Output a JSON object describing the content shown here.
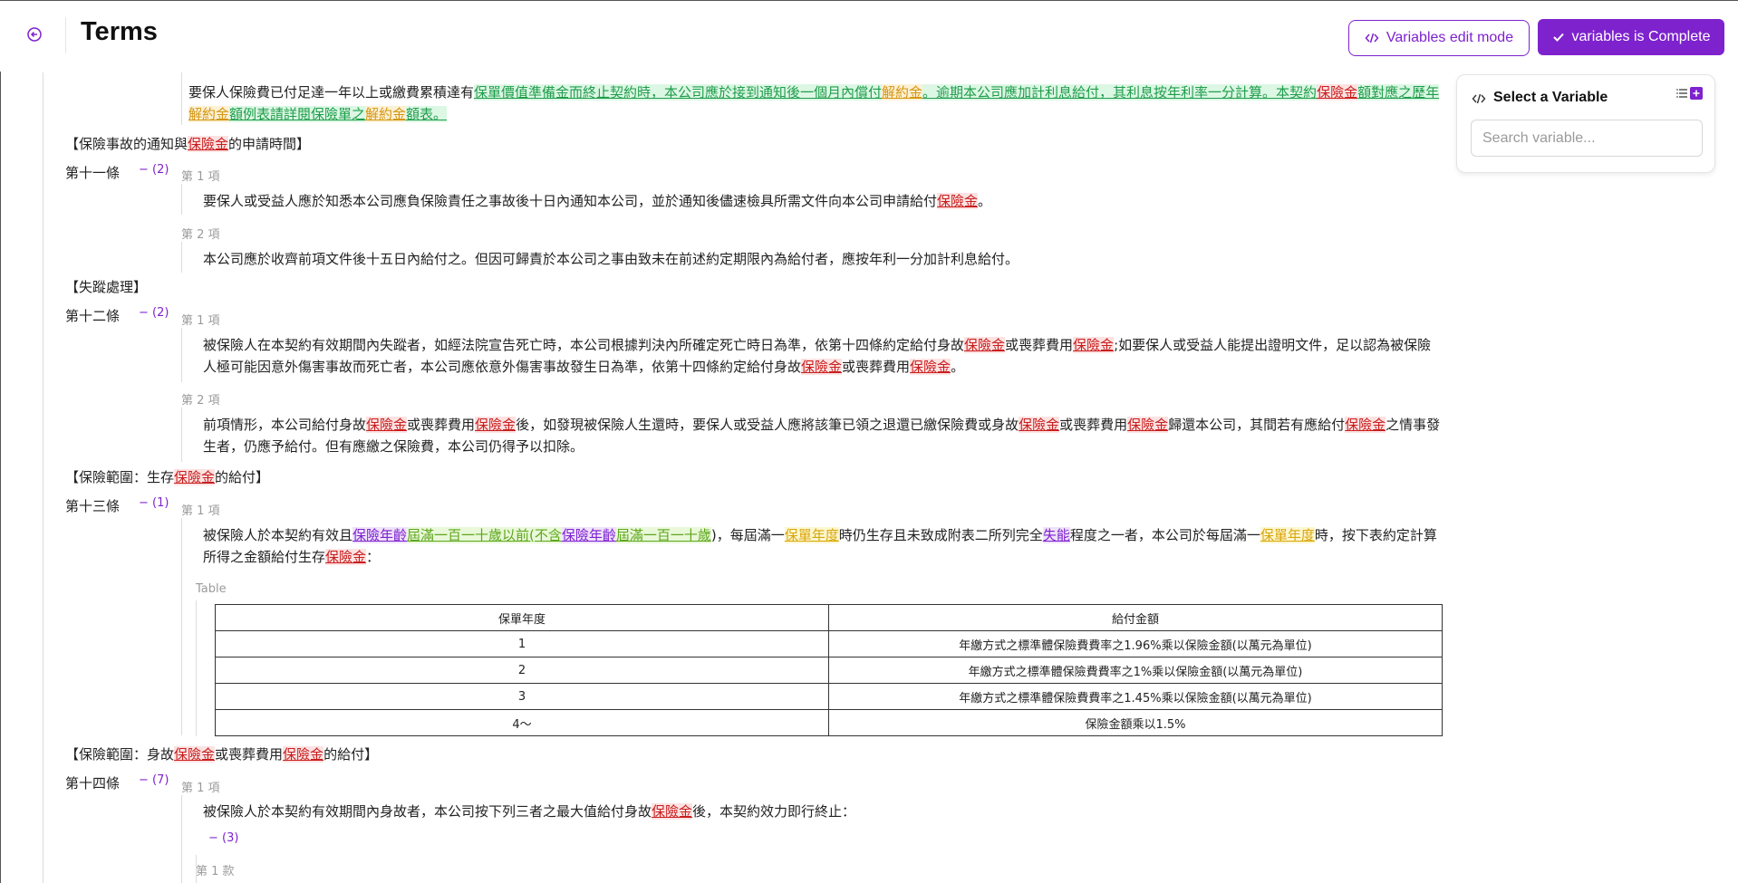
{
  "header": {
    "title": "Terms",
    "edit_mode_label": "Variables edit mode",
    "complete_label": "variables is Complete"
  },
  "variable_panel": {
    "title": "Select a Variable",
    "search_placeholder": "Search variable..."
  },
  "colors": {
    "accent": "#7e22ce",
    "red_var": "#c81e1e",
    "green_var": "#1f9d4b",
    "orange_var": "#d39612"
  },
  "content": {
    "top_para": {
      "a": "要保人保險費已付足達一年以上或繳費累積達有",
      "b": "保單價值準備金而終止契約時，本公司應於接到通知後一個月內償付",
      "c": "解約金",
      "d": "。逾期本公司應加計利息給付，其利息按年利率一分計算。本契約",
      "e": "保險金",
      "f": "額對應之歷年",
      "g": "解約金",
      "h": "額例表請詳閱保險單之",
      "i": "解約金",
      "j": "額表。"
    },
    "sec1": {
      "a": "【保險事故的通知與",
      "b": "保險金",
      "c": "的申請時間】"
    },
    "art11": {
      "label": "第十一條",
      "count": "− (2)",
      "item1": "第 1 項",
      "item2": "第 2 項",
      "p1a": "要保人或受益人應於知悉本公司應負保險責任之事故後十日內通知本公司，並於通知後儘速檢具所需文件向本公司申請給付",
      "p1b": "保險金",
      "p1c": "。",
      "p2": "本公司應於收齊前項文件後十五日內給付之。但因可歸責於本公司之事由致未在前述約定期限內為給付者，應按年利一分加計利息給付。"
    },
    "sec2": "【失蹤處理】",
    "art12": {
      "label": "第十二條",
      "count": "− (2)",
      "item1": "第 1 項",
      "item2": "第 2 項",
      "p1a": "被保險人在本契約有效期間內失蹤者，如經法院宣告死亡時，本公司根據判決內所確定死亡時日為準，依第十四條約定給付身故",
      "p1b": "保險金",
      "p1c": "或喪葬費用",
      "p1d": "保險金",
      "p1e": ";如要保人或受益人能提出證明文件，足以認為被保險人極可能因意外傷害事故而死亡者，本公司應依意外傷害事故發生日為準，依第十四條約定給付身故",
      "p1f": "保險金",
      "p1g": "或喪葬費用",
      "p1h": "保險金",
      "p1i": "。",
      "p2a": "前項情形，本公司給付身故",
      "p2b": "保險金",
      "p2c": "或喪葬費用",
      "p2d": "保險金",
      "p2e": "後，如發現被保險人生還時，要保人或受益人應將該筆已領之退還已繳保險費或身故",
      "p2f": "保險金",
      "p2g": "或喪葬費用",
      "p2h": "保險金",
      "p2i": "歸還本公司，其間若有應給付",
      "p2j": "保險金",
      "p2k": "之情事發生者，仍應予給付。但有應繳之保險費，本公司仍得予以扣除。"
    },
    "sec3": {
      "a": "【保險範圍：生存",
      "b": "保險金",
      "c": "的給付】"
    },
    "art13": {
      "label": "第十三條",
      "count": "− (1)",
      "item1": "第 1 項",
      "pa": "被保險人於本契約有效且",
      "pb": "保險年齡",
      "pc": "屆滿一百一十歲以前(不含",
      "pd": "保險年齡",
      "pe": "屆滿一百一十歲",
      "pf": ")，每屆滿一",
      "pg": "保單年度",
      "ph": "時仍生存且未致成附表二所列完全",
      "pi": "失能",
      "pj": "程度之一者，本公司於每屆滿一",
      "pk": "保單年度",
      "pl": "時，按下表約定計算所得之金額給付生存",
      "pm": "保險金",
      "pn": "：",
      "table_label": "Table",
      "table_headers": [
        "保單年度",
        "給付金額"
      ],
      "table_rows": [
        [
          "1",
          "年繳方式之標準體保險費費率之1.96%乘以保險金額(以萬元為單位)"
        ],
        [
          "2",
          "年繳方式之標準體保險費費率之1%乘以保險金額(以萬元為單位)"
        ],
        [
          "3",
          "年繳方式之標準體保險費費率之1.45%乘以保險金額(以萬元為單位)"
        ],
        [
          "4～",
          "保險金額乘以1.5%"
        ]
      ]
    },
    "sec4": {
      "a": "【保險範圍：身故",
      "b": "保險金",
      "c": "或喪葬費用",
      "d": "保險金",
      "e": "的給付】"
    },
    "art14": {
      "label": "第十四條",
      "count": "− (7)",
      "item1": "第 1 項",
      "pa": "被保險人於本契約有效期間內身故者，本公司按下列三者之最大值給付身故",
      "pb": "保險金",
      "pc": "後，本契約效力即行終止：",
      "sub_count": "− (3)",
      "sub_label": "第 1 款"
    }
  }
}
